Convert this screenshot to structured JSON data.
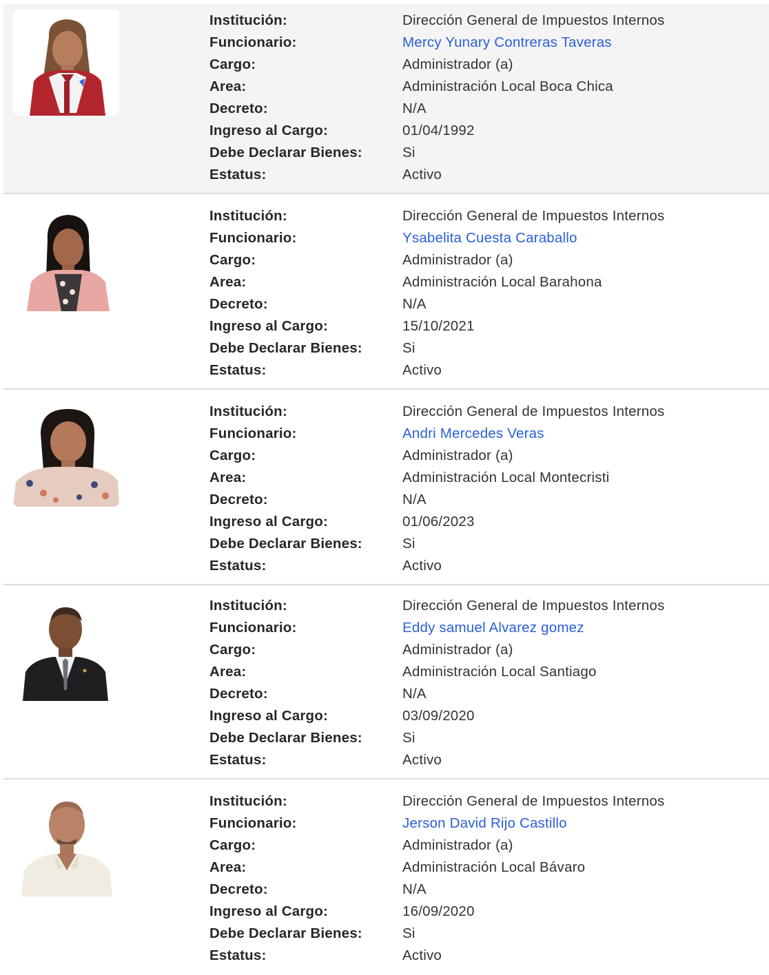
{
  "labels": {
    "institucion": "Institución:",
    "funcionario": "Funcionario:",
    "cargo": "Cargo:",
    "area": "Area:",
    "decreto": "Decreto:",
    "ingreso": "Ingreso al Cargo:",
    "declarar": "Debe Declarar Bienes:",
    "estatus": "Estatus:"
  },
  "colors": {
    "link": "#2b5fd9",
    "shaded_row": "#f4f4f4",
    "divider": "#dcdcdc"
  },
  "officials": [
    {
      "institucion": "Dirección General de Impuestos Internos",
      "funcionario": "Mercy Yunary Contreras Taveras",
      "cargo": "Administrador (a)",
      "area": "Administración Local Boca Chica",
      "decreto": "N/A",
      "ingreso": "01/04/1992",
      "declarar": "Si",
      "estatus": "Activo",
      "photo_icon": "woman-red-jacket-portrait"
    },
    {
      "institucion": "Dirección General de Impuestos Internos",
      "funcionario": "Ysabelita Cuesta Caraballo",
      "cargo": "Administrador (a)",
      "area": "Administración Local Barahona",
      "decreto": "N/A",
      "ingreso": "15/10/2021",
      "declarar": "Si",
      "estatus": "Activo",
      "photo_icon": "woman-pink-blazer-portrait"
    },
    {
      "institucion": "Dirección General de Impuestos Internos",
      "funcionario": "Andri Mercedes Veras",
      "cargo": "Administrador (a)",
      "area": "Administración Local Montecristi",
      "decreto": "N/A",
      "ingreso": "01/06/2023",
      "declarar": "Si",
      "estatus": "Activo",
      "photo_icon": "woman-floral-blouse-portrait"
    },
    {
      "institucion": "Dirección General de Impuestos Internos",
      "funcionario": "Eddy samuel Alvarez gomez",
      "cargo": "Administrador (a)",
      "area": "Administración Local Santiago",
      "decreto": "N/A",
      "ingreso": "03/09/2020",
      "declarar": "Si",
      "estatus": "Activo",
      "photo_icon": "man-dark-suit-portrait"
    },
    {
      "institucion": "Dirección General de Impuestos Internos",
      "funcionario": "Jerson David Rijo Castillo",
      "cargo": "Administrador (a)",
      "area": "Administración Local Bávaro",
      "decreto": "N/A",
      "ingreso": "16/09/2020",
      "declarar": "Si",
      "estatus": "Activo",
      "photo_icon": "man-white-shirt-portrait"
    }
  ]
}
